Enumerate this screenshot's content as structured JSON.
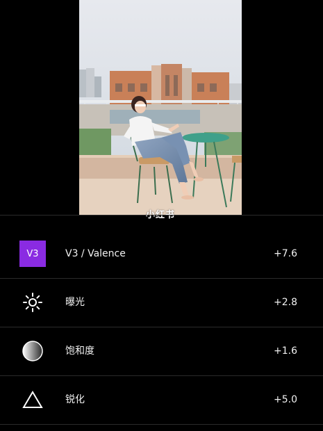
{
  "photo": {
    "watermark": "小红书"
  },
  "adjustments": [
    {
      "icon": "preset-badge-icon",
      "badge": "V3",
      "label": "V3 / Valence",
      "value": "+7.6"
    },
    {
      "icon": "sun-icon",
      "label": "曝光",
      "value": "+2.8"
    },
    {
      "icon": "gradient-circle-icon",
      "label": "饱和度",
      "value": "+1.6"
    },
    {
      "icon": "triangle-icon",
      "label": "锐化",
      "value": "+5.0"
    }
  ],
  "colors": {
    "background": "#000000",
    "accent": "#8a2be2",
    "divider": "#2b2b2b"
  }
}
